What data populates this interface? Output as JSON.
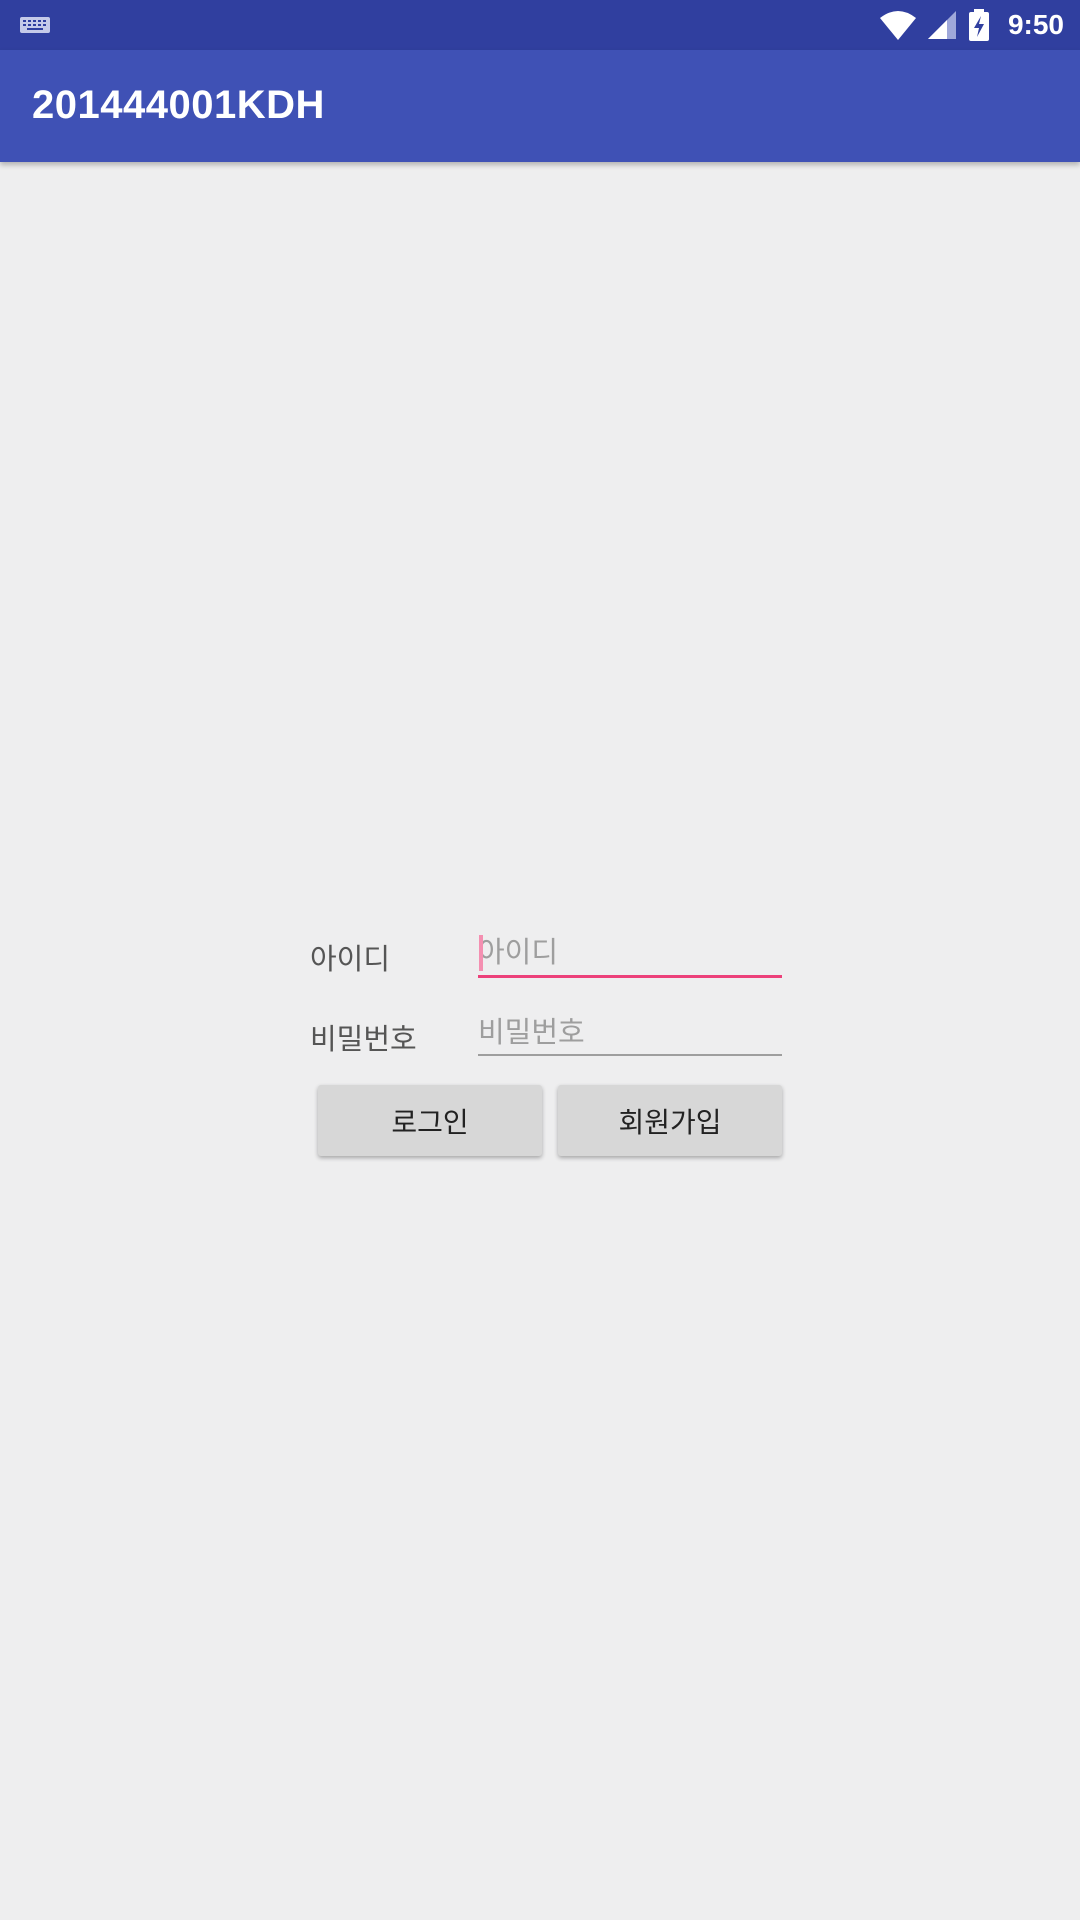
{
  "status_bar": {
    "time": "9:50",
    "icons": [
      "keyboard-icon",
      "wifi-icon",
      "cellular-signal-icon",
      "battery-charging-icon"
    ],
    "color": "#303f9f"
  },
  "app_bar": {
    "title": "201444001KDH",
    "color": "#3f51b5"
  },
  "login_form": {
    "id_label": "아이디",
    "id_placeholder": "아이디",
    "id_value": "",
    "password_label": "비밀번호",
    "password_placeholder": "비밀번호",
    "password_value": "",
    "focus_color": "#ec407a",
    "login_button": "로그인",
    "signup_button": "회원가입"
  }
}
